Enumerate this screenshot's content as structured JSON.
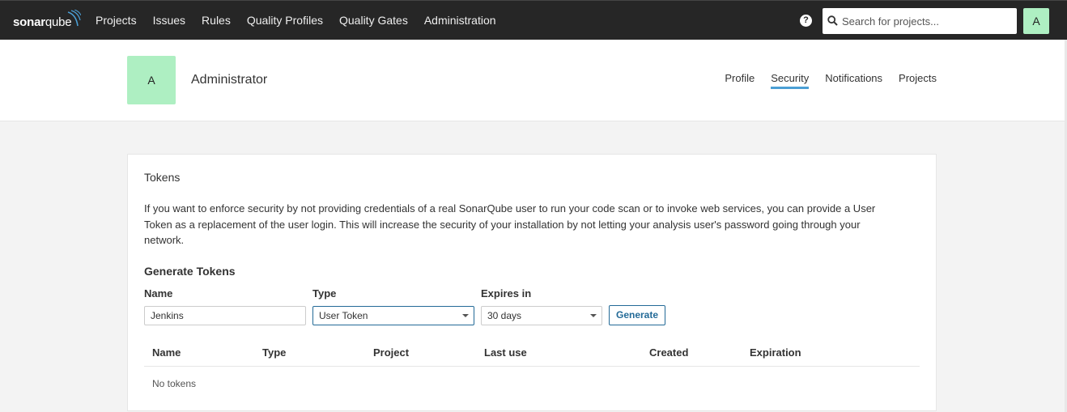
{
  "topbar": {
    "logo": {
      "bold": "sonar",
      "light": "qube"
    },
    "nav": [
      "Projects",
      "Issues",
      "Rules",
      "Quality Profiles",
      "Quality Gates",
      "Administration"
    ],
    "help_icon": "?",
    "search_placeholder": "Search for projects...",
    "avatar_letter": "A"
  },
  "header": {
    "avatar_letter": "A",
    "username": "Administrator",
    "tabs": [
      {
        "label": "Profile",
        "active": false
      },
      {
        "label": "Security",
        "active": true
      },
      {
        "label": "Notifications",
        "active": false
      },
      {
        "label": "Projects",
        "active": false
      }
    ]
  },
  "tokens": {
    "title": "Tokens",
    "description": "If you want to enforce security by not providing credentials of a real SonarQube user to run your code scan or to invoke web services, you can provide a User Token as a replacement of the user login. This will increase the security of your installation by not letting your analysis user's password going through your network.",
    "generate_title": "Generate Tokens",
    "form": {
      "name_label": "Name",
      "name_value": "Jenkins",
      "type_label": "Type",
      "type_value": "User Token",
      "expires_label": "Expires in",
      "expires_value": "30 days",
      "generate_button": "Generate"
    },
    "table": {
      "columns": [
        "Name",
        "Type",
        "Project",
        "Last use",
        "Created",
        "Expiration"
      ],
      "empty_text": "No tokens"
    }
  },
  "colors": {
    "accent": "#4b9fd5",
    "button": "#236a97",
    "avatar": "#aeefc2",
    "topbar": "#262626"
  }
}
